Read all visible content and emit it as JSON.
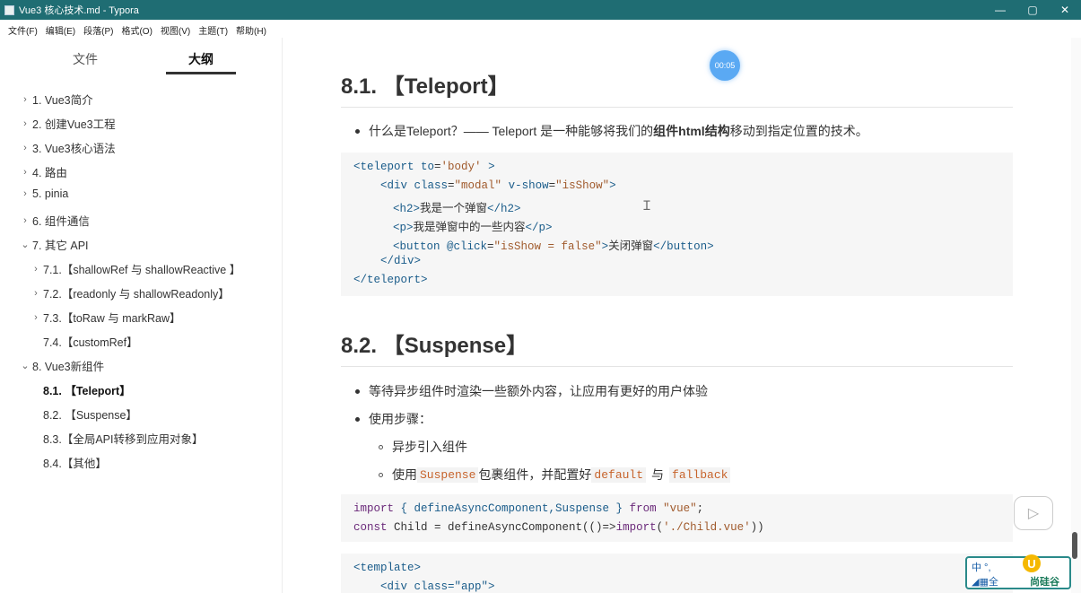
{
  "window": {
    "title": "Vue3 核心技术.md - Typora",
    "controls": [
      "—",
      "▢",
      "✕"
    ]
  },
  "menu": [
    "文件(F)",
    "编辑(E)",
    "段落(P)",
    "格式(O)",
    "视图(V)",
    "主题(T)",
    "帮助(H)"
  ],
  "sidebar": {
    "tabs": [
      "文件",
      "大纲"
    ],
    "outline": [
      {
        "arrow": "›",
        "label": "1. Vue3简介"
      },
      {
        "arrow": "›",
        "label": "2. 创建Vue3工程"
      },
      {
        "arrow": "›",
        "label": "3. Vue3核心语法"
      },
      {
        "arrow": "›",
        "label": "4. 路由"
      },
      {
        "arrow": "›",
        "label": "5. pinia"
      },
      {
        "arrow": "›",
        "label": "6. 组件通信"
      },
      {
        "arrow": "⌄",
        "label": "7. 其它 API"
      },
      {
        "arrow": "›",
        "label": "7.1.【shallowRef 与 shallowReactive 】"
      },
      {
        "arrow": "›",
        "label": "7.2.【readonly 与 shallowReadonly】"
      },
      {
        "arrow": "›",
        "label": "7.3.【toRaw 与 markRaw】"
      },
      {
        "arrow": "",
        "label": "7.4.【customRef】"
      },
      {
        "arrow": "⌄",
        "label": "8. Vue3新组件"
      },
      {
        "arrow": "",
        "label": "8.1. 【Teleport】"
      },
      {
        "arrow": "",
        "label": "8.2. 【Suspense】"
      },
      {
        "arrow": "",
        "label": "8.3.【全局API转移到应用对象】"
      },
      {
        "arrow": "",
        "label": "8.4.【其他】"
      }
    ]
  },
  "main": {
    "timer": "00:05",
    "h1": "8.1. 【Teleport】",
    "p1": {
      "prefix": "什么是Teleport？—— Teleport 是一种能够将我们的",
      "bold1": "组件html结构",
      "suffix": "移动到指定位置的技术。"
    },
    "code1": {
      "l1": {
        "a": "<teleport ",
        "b": "to",
        "c": "=",
        "d": "'body'",
        "e": " >"
      },
      "l2": {
        "a": "<div ",
        "b": "class",
        "c": "=",
        "d": "\"modal\"",
        "e": " ",
        "f": "v-show",
        "g": "=",
        "h": "\"isShow\"",
        "i": ">"
      },
      "l3": {
        "a": "<h2>",
        "b": "我是一个弹窗",
        "c": "</h2>"
      },
      "l4": {
        "a": "<p>",
        "b": "我是弹窗中的一些内容",
        "c": "</p>"
      },
      "l5": {
        "a": "<button ",
        "b": "@click",
        "c": "=",
        "d": "\"isShow = false\"",
        "e": ">",
        "f": "关闭弹窗",
        "g": "</button>"
      },
      "l6": "</div>",
      "l7": "</teleport>"
    },
    "h2": "8.2. 【Suspense】",
    "p2": "等待异步组件时渲染一些额外内容，让应用有更好的用户体验",
    "p3": "使用步骤：",
    "sub1": "异步引入组件",
    "sub2": {
      "a": "使用",
      "b": "Suspense",
      "c": "包裹组件，并配置好",
      "d": "default",
      "e": "与",
      "f": "fallback"
    },
    "code2": {
      "l1": {
        "a": "import",
        "b": " { defineAsyncComponent,Suspense } ",
        "c": "from",
        "d": " ",
        "e": "\"vue\"",
        "f": ";"
      },
      "l2": {
        "a": "const",
        "b": " Child = defineAsyncComponent(()=>",
        "c": "import",
        "d": "(",
        "e": "'./Child.vue'",
        "f": "))"
      }
    },
    "code3": {
      "l1": "<template>",
      "l2": "<div class=\"app\">"
    }
  },
  "ime": {
    "left_top": "中 °,",
    "left_bottom": "◢▦全",
    "brand": "尚硅谷"
  },
  "colors": {
    "titlebar": "#1f6d73",
    "tag": "#1a5c8a",
    "string": "#a05a2c",
    "keyword": "#6b2a7a",
    "inline_code": "#c7632b"
  }
}
